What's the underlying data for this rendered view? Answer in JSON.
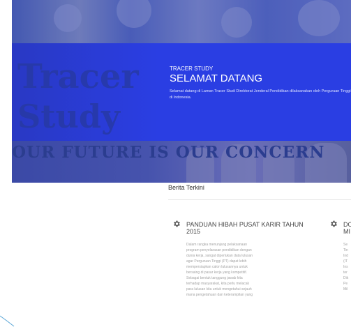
{
  "hero": {
    "eyebrow": "TRACER STUDY",
    "title": "SELAMAT DATANG",
    "description": "Selamat datang di Laman Tracer Studi Direktorat Jenderal Pendidikan dilaksanakan oleh Perguruan Tinggi di Indonesia.",
    "art_word_1": "Tracer",
    "art_word_2": "Study",
    "slogan": "OUR FUTURE IS OUR CONCERN"
  },
  "section": {
    "title": "Berita Terkini"
  },
  "news": [
    {
      "title": "PANDUAN HIBAH PUSAT KARIR TAHUN 2015",
      "body": [
        "Dalam rangka menunjang pelaksanaan",
        "program penyelarasan pendidikan dengan",
        "dunia kerja, sangat diperlukan data lulusan",
        "agar Perguruan Tinggi (PT) dapat lebih",
        "mempersiapkan calon lulusannya untuk",
        "bersaing di pasar kerja yang kompetitif.",
        "Sebagai bentuk tanggung jawab kita",
        "terhadap masyarakat, kita perlu melacak",
        "para lulusan kita untuk mengetahui sejauh",
        "mana pengetahuan dan keterampilan yang"
      ]
    },
    {
      "title": "DO MI",
      "body": [
        "Se",
        "Tin",
        "Ind",
        "(IT",
        "Ins",
        "ter",
        "Dik",
        "Pe",
        "Mil"
      ]
    }
  ],
  "colors": {
    "hero_blue": "#2a3ee3",
    "accent_dark": "#1f34c7"
  }
}
